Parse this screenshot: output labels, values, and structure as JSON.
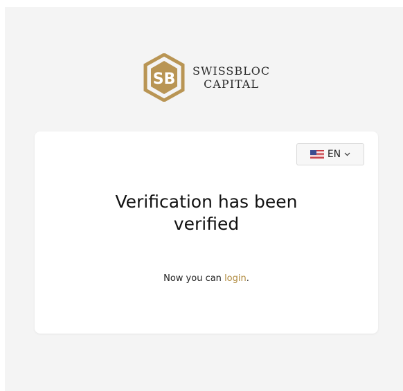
{
  "brand": {
    "line1": "SWISSBLOC",
    "line2": "CAPITAL",
    "accent_color": "#b99554"
  },
  "language": {
    "code": "EN",
    "flag_icon": "us-flag-icon",
    "chevron_icon": "chevron-down-icon"
  },
  "card": {
    "title_line1": "Verification has been",
    "title_line2": "verified",
    "message_prefix": "Now you can ",
    "login_link": "login",
    "message_suffix": ".",
    "link_color": "#b08a3e"
  }
}
